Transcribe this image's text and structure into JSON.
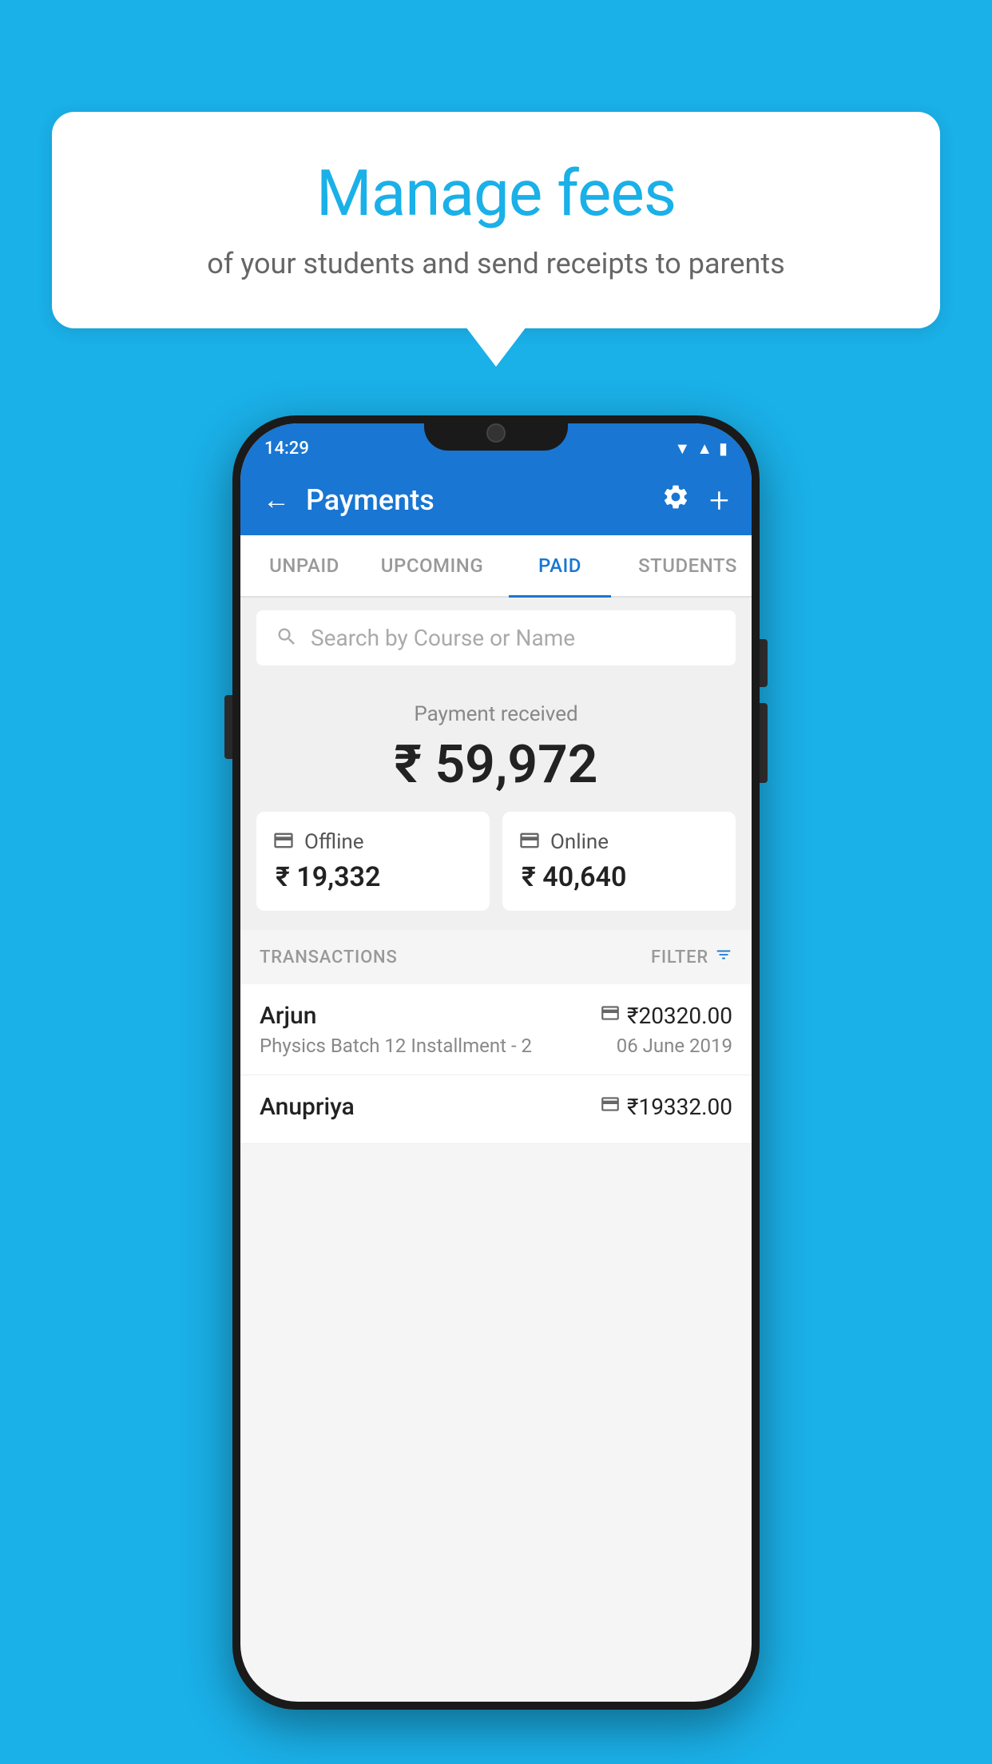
{
  "page": {
    "background_color": "#1ab0e8"
  },
  "speech_bubble": {
    "title": "Manage fees",
    "subtitle": "of your students and send receipts to parents"
  },
  "status_bar": {
    "time": "14:29",
    "wifi": "▼",
    "signal": "▲",
    "battery": "▮"
  },
  "app_bar": {
    "title": "Payments",
    "back_label": "←",
    "gear_label": "⚙",
    "plus_label": "+"
  },
  "tabs": [
    {
      "label": "UNPAID",
      "active": false
    },
    {
      "label": "UPCOMING",
      "active": false
    },
    {
      "label": "PAID",
      "active": true
    },
    {
      "label": "STUDENTS",
      "active": false
    }
  ],
  "search": {
    "placeholder": "Search by Course or Name"
  },
  "payment_received": {
    "label": "Payment received",
    "total": "₹ 59,972",
    "offline": {
      "type": "Offline",
      "amount": "₹ 19,332"
    },
    "online": {
      "type": "Online",
      "amount": "₹ 40,640"
    }
  },
  "transactions": {
    "section_label": "TRANSACTIONS",
    "filter_label": "FILTER",
    "rows": [
      {
        "name": "Arjun",
        "amount": "₹20320.00",
        "payment_type": "online",
        "course": "Physics Batch 12 Installment - 2",
        "date": "06 June 2019"
      },
      {
        "name": "Anupriya",
        "amount": "₹19332.00",
        "payment_type": "offline",
        "course": "",
        "date": ""
      }
    ]
  }
}
